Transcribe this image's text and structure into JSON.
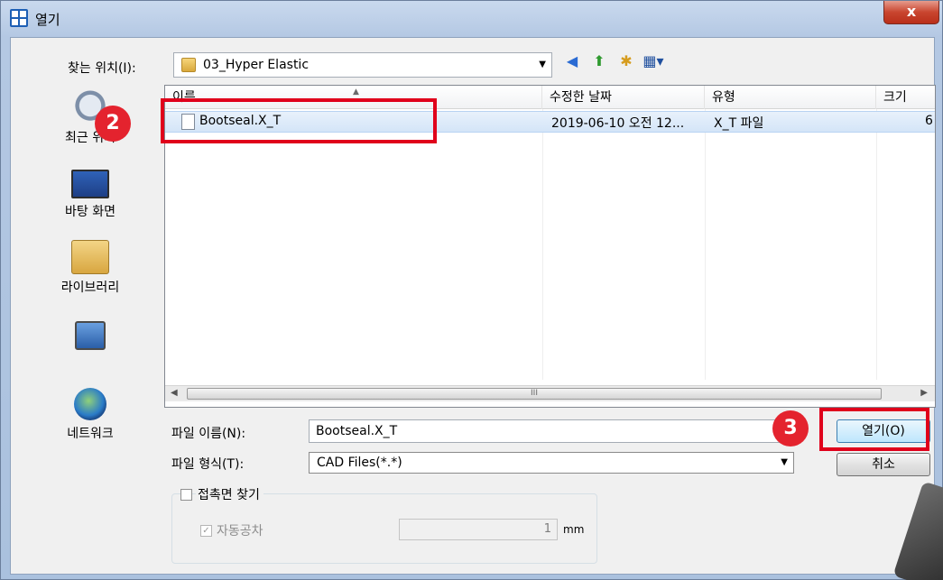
{
  "window": {
    "title": "열기",
    "close_label": "x"
  },
  "lookin": {
    "label": "찾는 위치(I):",
    "value": "03_Hyper Elastic"
  },
  "places": [
    {
      "label": "최근 위치"
    },
    {
      "label": "바탕 화면"
    },
    {
      "label": "라이브러리"
    },
    {
      "label": ""
    },
    {
      "label": "네트워크"
    }
  ],
  "list": {
    "columns": [
      "이름",
      "수정한 날짜",
      "유형",
      "크기"
    ],
    "rows": [
      {
        "name": "Bootseal.X_T",
        "date": "2019-06-10 오전 12...",
        "type": "X_T 파일",
        "size": "6"
      }
    ],
    "scroll_mark": "III"
  },
  "filename": {
    "label": "파일 이름(N):",
    "value": "Bootseal.X_T"
  },
  "filetype": {
    "label": "파일 형식(T):",
    "value": "CAD Files(*.*)"
  },
  "buttons": {
    "open": "열기(O)",
    "cancel": "취소"
  },
  "options": {
    "contact_label": "접촉면 찾기",
    "contact_checked": false,
    "auto_tolerance_label": "자동공차",
    "auto_tolerance_checked": true,
    "tolerance_value": "1",
    "tolerance_unit": "mm"
  },
  "annotations": {
    "badge_2": "2",
    "badge_3": "3",
    "highlight_color": "#e0001b"
  }
}
